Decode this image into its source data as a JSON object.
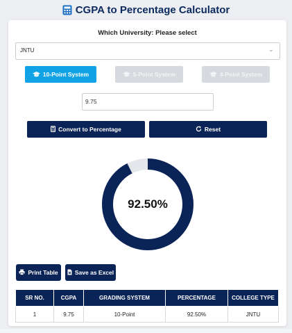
{
  "header": {
    "title": "CGPA to Percentage Calculator",
    "icon": "calculator-icon"
  },
  "form": {
    "university_label": "Which University: Please select",
    "university_value": "JNTU",
    "systems": [
      {
        "label": "10-Point System",
        "active": true
      },
      {
        "label": "5-Point System",
        "active": false
      },
      {
        "label": "4-Point System",
        "active": false
      }
    ],
    "cgpa_value": "9.75",
    "convert_label": "Convert to Percentage",
    "reset_label": "Reset"
  },
  "result": {
    "percentage_text": "92.50%",
    "percentage_value": 92.5
  },
  "actions": {
    "print_label": "Print Table",
    "excel_label": "Save as Excel"
  },
  "table": {
    "headers": [
      "SR NO.",
      "CGPA",
      "GRADING SYSTEM",
      "PERCENTAGE",
      "COLLEGE TYPE"
    ],
    "rows": [
      [
        "1",
        "9.75",
        "10-Point",
        "92.50%",
        "JNTU"
      ]
    ]
  },
  "colors": {
    "primary": "#0b2458",
    "accent": "#12a3e6",
    "ring_track": "#e3e6ea",
    "title": "#0b2a5e"
  }
}
